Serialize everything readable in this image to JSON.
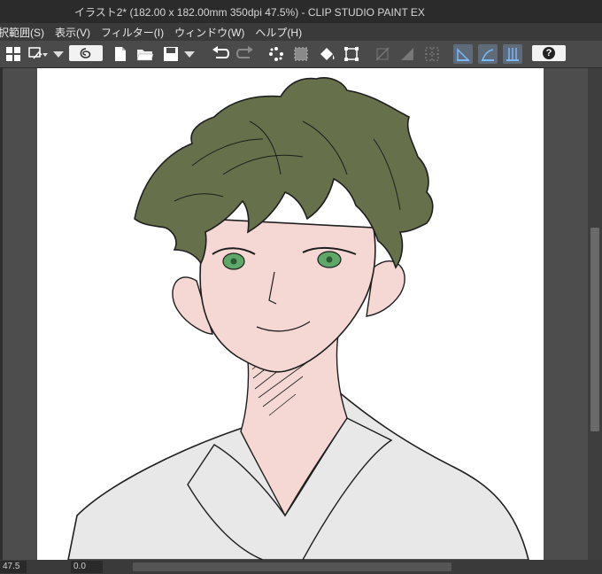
{
  "window": {
    "title": "イラスト2* (182.00 x 182.00mm 350dpi 47.5%)  - CLIP STUDIO PAINT EX"
  },
  "menu": {
    "items": [
      {
        "label": "択範囲(S)"
      },
      {
        "label": "表示(V)"
      },
      {
        "label": "フィルター(I)"
      },
      {
        "label": "ウィンドウ(W)"
      },
      {
        "label": "ヘルプ(H)"
      }
    ]
  },
  "toolbar": {
    "icons": [
      "grid-layout-icon",
      "ribbon-menu-icon",
      "clip-studio-logo-icon",
      "new-file-icon",
      "open-file-icon",
      "save-icon",
      "undo-icon",
      "redo-icon",
      "transform-dots-icon",
      "selection-icon",
      "fill-icon",
      "scale-icon",
      "ruler-off-icon",
      "draw-ruler-icon",
      "grid-toggle-icon",
      "snap-ruler-icon",
      "snap-special-ruler-icon",
      "snap-grid-icon",
      "help-icon"
    ],
    "help_label": "?"
  },
  "status": {
    "zoom_value": "47.5",
    "rotation_value": "0.0"
  },
  "colors": {
    "hair": "#66704a",
    "skin": "#f5d8d4",
    "eyes": "#5fa86a",
    "kimono": "#e8e8e8",
    "line": "#1e1e1e"
  }
}
